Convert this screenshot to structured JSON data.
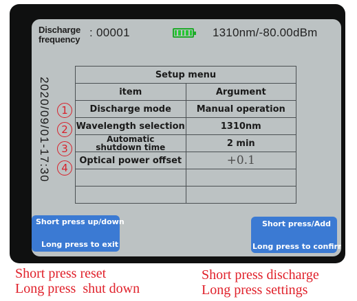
{
  "header": {
    "freq_label_line1": "Discharge",
    "freq_label_line2": "frequency",
    "freq_value": ": 00001",
    "reading": "1310nm/-80.00dBm",
    "battery_color": "#27c735"
  },
  "datetime": "2020/09/01-17:30",
  "menu": {
    "title": "Setup menu",
    "col_item": "item",
    "col_argument": "Argument",
    "rows": [
      {
        "num": "1",
        "item": "Discharge mode",
        "argument": "Manual operation"
      },
      {
        "num": "2",
        "item": "Wavelength selection",
        "argument": "1310nm"
      },
      {
        "num": "3",
        "item_line1": "Automatic",
        "item_line2": "shutdown time",
        "argument": "2 min"
      },
      {
        "num": "4",
        "item": "Optical power offset",
        "argument": "+0.1"
      }
    ]
  },
  "buttons": {
    "left_line1": "Short press up/down",
    "left_line2": "Long press to exit",
    "right_line1": "Short press/Add",
    "right_line2": "Long press to confirm"
  },
  "captions": {
    "left_line1": "Short press reset",
    "left_line2": "Long press  shut down",
    "right_line1": "Short press discharge",
    "right_line2": "Long press settings"
  },
  "colors": {
    "screen_bg": "#bcc2c3",
    "button_blue": "#3b7ad3",
    "annotation_red": "#e0202a"
  }
}
